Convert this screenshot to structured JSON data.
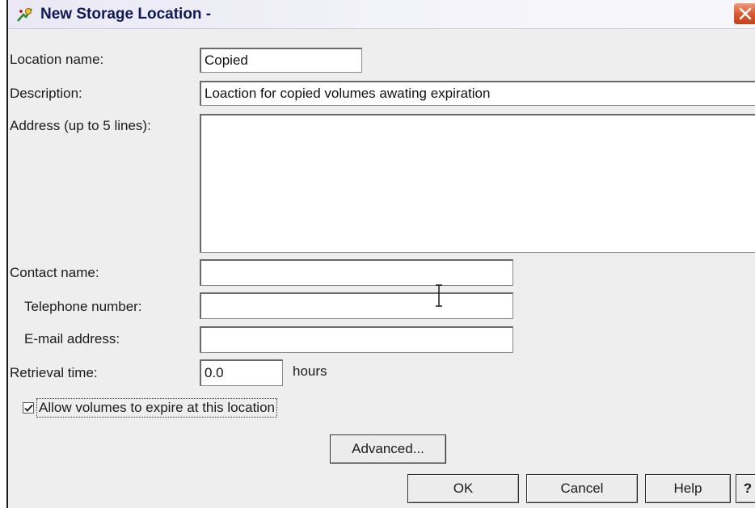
{
  "window": {
    "title": "New Storage Location -",
    "title_icon": "storage-location-app-icon",
    "close_icon": "close-x-icon"
  },
  "form": {
    "location_name": {
      "label": "Location name:",
      "value": "Copied"
    },
    "description": {
      "label": "Description:",
      "value": "Loaction for copied volumes awating expiration"
    },
    "address": {
      "label": "Address (up to 5 lines):",
      "value": ""
    },
    "contact_name": {
      "label": "Contact name:",
      "value": ""
    },
    "telephone": {
      "label": "Telephone number:",
      "value": ""
    },
    "email": {
      "label": "E-mail address:",
      "value": ""
    },
    "retrieval_time": {
      "label": "Retrieval time:",
      "value": "0.0",
      "unit": "hours"
    },
    "allow_expire": {
      "label": "Allow volumes to expire at this location",
      "checked": true
    }
  },
  "buttons": {
    "advanced": "Advanced...",
    "ok": "OK",
    "cancel": "Cancel",
    "help": "Help",
    "context_help": "?"
  },
  "colors": {
    "title_text": "#0f1a55",
    "close_button": "#d9562e",
    "dialog_background": "#eeeeee"
  }
}
